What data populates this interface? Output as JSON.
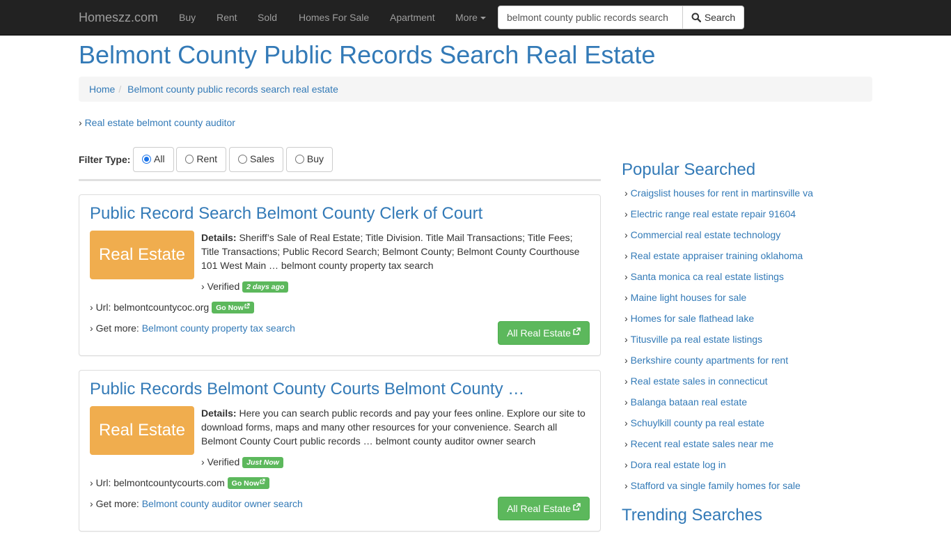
{
  "navbar": {
    "brand": "Homeszz.com",
    "items": [
      "Buy",
      "Rent",
      "Sold",
      "Homes For Sale",
      "Apartment"
    ],
    "more_label": "More",
    "search": {
      "value": "belmont county public records search",
      "button_label": "Search"
    }
  },
  "page": {
    "title": "Belmont County Public Records Search Real Estate",
    "breadcrumb": [
      "Home",
      "Belmont county public records search real estate"
    ],
    "related_link": "Real estate belmont county auditor"
  },
  "filter": {
    "label": "Filter Type:",
    "options": [
      "All",
      "Rent",
      "Sales",
      "Buy"
    ],
    "selected": "All"
  },
  "results": [
    {
      "title": "Public Record Search Belmont County Clerk of Court",
      "category": "Real Estate",
      "details_label": "Details:",
      "details": "Sheriff’s Sale of Real Estate; Title Division. Title Mail Transactions; Title Fees; Title Transactions; Public Record Search; Belmont County; Belmont County Courthouse 101 West Main … belmont county property tax search",
      "verified_label": "Verified",
      "verified_time": "2 days ago",
      "url_label": "Url:",
      "url": "belmontcountycoc.org",
      "go_now": "Go Now",
      "get_more_label": "Get more:",
      "get_more_link": "Belmont county property tax search",
      "all_button": "All Real Estate"
    },
    {
      "title": "Public Records Belmont County Courts Belmont County …",
      "category": "Real Estate",
      "details_label": "Details:",
      "details": "Here you can search public records and pay your fees online. Explore our site to download forms, maps and many other resources for your convenience. Search all Belmont County Court public records … belmont county auditor owner search",
      "verified_label": "Verified",
      "verified_time": "Just Now",
      "url_label": "Url:",
      "url": "belmontcountycourts.com",
      "go_now": "Go Now",
      "get_more_label": "Get more:",
      "get_more_link": "Belmont county auditor owner search",
      "all_button": "All Real Estate"
    }
  ],
  "sidebar": {
    "popular_title": "Popular Searched",
    "popular": [
      "Craigslist houses for rent in martinsville va",
      "Electric range real estate repair 91604",
      "Commercial real estate technology",
      "Real estate appraiser training oklahoma",
      "Santa monica ca real estate listings",
      "Maine light houses for sale",
      "Homes for sale flathead lake",
      "Titusville pa real estate listings",
      "Berkshire county apartments for rent",
      "Real estate sales in connecticut",
      "Balanga bataan real estate",
      "Schuylkill county pa real estate",
      "Recent real estate sales near me",
      "Dora real estate log in",
      "Stafford va single family homes for sale"
    ],
    "trending_title": "Trending Searches"
  },
  "colors": {
    "navbar_bg": "#222222",
    "link": "#337ab7",
    "category_badge": "#f0ad4e",
    "success": "#5cb85c"
  }
}
